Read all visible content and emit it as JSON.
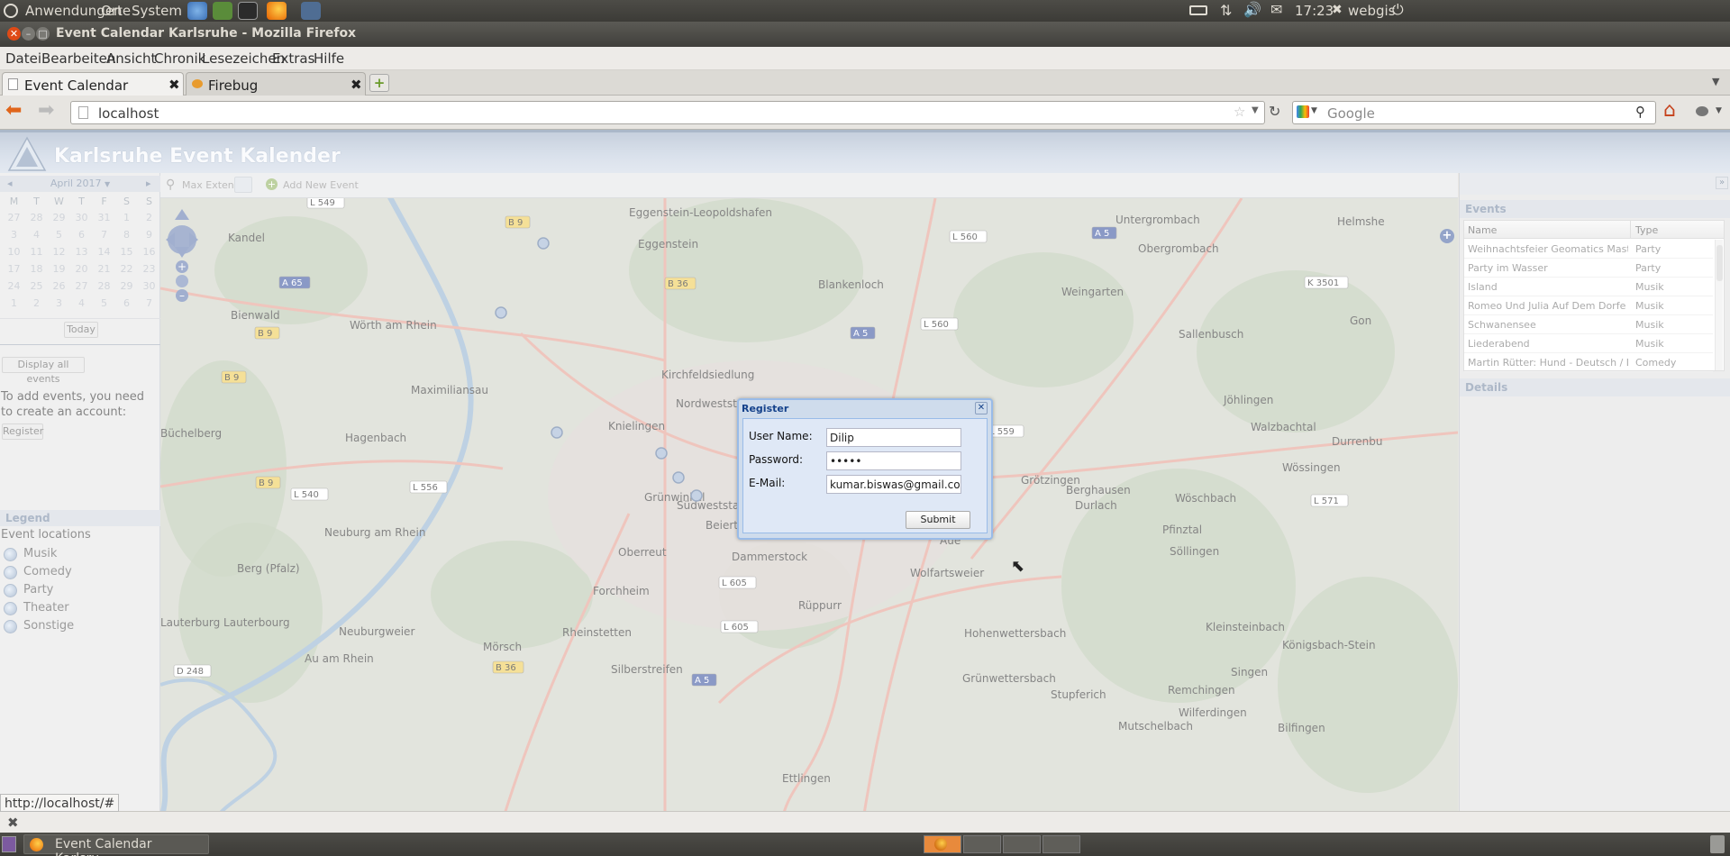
{
  "top_panel": {
    "menus": [
      "Anwendungen",
      "Orte",
      "System"
    ],
    "clock": "17:23",
    "user": "webgis"
  },
  "window": {
    "title": "Event Calendar Karlsruhe - Mozilla Firefox"
  },
  "firefox": {
    "menu": [
      "Datei",
      "Bearbeiten",
      "Ansicht",
      "Chronik",
      "Lesezeichen",
      "Extras",
      "Hilfe"
    ],
    "tabs": [
      {
        "label": "Event Calendar Karlsruhe",
        "active": true
      },
      {
        "label": "Firebug",
        "active": false
      }
    ],
    "url": "localhost",
    "search_placeholder": "Google",
    "status_url": "http://localhost/#"
  },
  "app": {
    "title": "Karlsruhe Event Kalender",
    "calendar": {
      "month_label": "April 2017",
      "dow": [
        "M",
        "T",
        "W",
        "T",
        "F",
        "S",
        "S"
      ],
      "weeks": [
        [
          "27",
          "28",
          "29",
          "30",
          "31",
          "1",
          "2"
        ],
        [
          "3",
          "4",
          "5",
          "6",
          "7",
          "8",
          "9"
        ],
        [
          "10",
          "11",
          "12",
          "13",
          "14",
          "15",
          "16"
        ],
        [
          "17",
          "18",
          "19",
          "20",
          "21",
          "22",
          "23"
        ],
        [
          "24",
          "25",
          "26",
          "27",
          "28",
          "29",
          "30"
        ],
        [
          "1",
          "2",
          "3",
          "4",
          "5",
          "6",
          "7"
        ]
      ],
      "today_label": "Today"
    },
    "display_all_label": "Display all events",
    "account_text": "To add events, you need to create an account:",
    "register_button": "Register",
    "legend": {
      "title": "Legend",
      "subtitle": "Event locations",
      "items": [
        "Musik",
        "Comedy",
        "Party",
        "Theater",
        "Sonstige"
      ]
    },
    "toolbar": {
      "max_extent": "Max Extent",
      "add_event": "Add New Event"
    },
    "events": {
      "title": "Events",
      "columns": [
        "Name",
        "Type"
      ],
      "rows": [
        {
          "name": "Weihnachtsfeier Geomatics Master",
          "type": "Party"
        },
        {
          "name": "Party im Wasser",
          "type": "Party"
        },
        {
          "name": "Island",
          "type": "Musik"
        },
        {
          "name": "Romeo Und Julia Auf Dem Dorfe",
          "type": "Musik"
        },
        {
          "name": "Schwanensee",
          "type": "Musik"
        },
        {
          "name": "Liederabend",
          "type": "Musik"
        },
        {
          "name": "Martin Rütter: Hund - Deutsch / D...",
          "type": "Comedy"
        }
      ]
    },
    "details_title": "Details"
  },
  "map_labels": [
    "Kandel",
    "Wörth am Rhein",
    "Maximiliansau",
    "Hagenbach",
    "Büchelberg",
    "Neuburg am Rhein",
    "Berg (Pfalz)",
    "Lauterburg Lauterbourg",
    "Neuburgweier",
    "Au am Rhein",
    "Eggenstein-Leopoldshafen",
    "Eggenstein",
    "Blankenloch",
    "Weingarten",
    "Untergrombach",
    "Obergrombach",
    "Sallenbusch",
    "Jöhlingen",
    "Walzbachtal",
    "Wössingen",
    "Berghausen",
    "Grötzingen",
    "Durlach",
    "Wöschbach",
    "Pfinztal",
    "Söllingen",
    "Knielingen",
    "Nordweststadt",
    "Grünwinkel",
    "Südweststadt",
    "Beiertheim",
    "Oberreut",
    "Dammerstock",
    "Forchheim",
    "Rheinstetten",
    "Mörsch",
    "Silberstreifen",
    "Rüppurr",
    "Wolfartsweier",
    "Hohenwettersbach",
    "Grünwettersbach",
    "Stupferich",
    "Remchingen",
    "Wilferdingen",
    "Königsbach-Stein",
    "Kleinsteinbach",
    "Singen",
    "Mutschelbach",
    "Bilfingen",
    "Ettlingen",
    "Kirchfeldsiedlung",
    "Aue",
    "Bienwald",
    "Durrenbu",
    "Helmshe",
    "Gon"
  ],
  "road_labels": [
    "L 549",
    "B 9",
    "A 65",
    "B 9",
    "B 9",
    "B 9",
    "L 540",
    "L 556",
    "B 36",
    "L 560",
    "L 560",
    "A 5",
    "A 5",
    "K 3501",
    "L 571",
    "L 605",
    "L 605",
    "B 36",
    "A 5",
    "D 248",
    "L 559"
  ],
  "dialog": {
    "title": "Register",
    "username_label": "User Name:",
    "username_value": "Dilip",
    "password_label": "Password:",
    "password_value": "•••••",
    "email_label": "E-Mail:",
    "email_value": "kumar.biswas@gmail.com",
    "submit_label": "Submit"
  },
  "taskbar": {
    "window_label": "Event Calendar Karlsru..."
  },
  "colors": {
    "panel_dark": "#3c3b37",
    "app_header": "#c7d2e2",
    "dialog_bg": "#dfe8f6",
    "dialog_title": "#15428b",
    "firefox_orange": "#e66000"
  }
}
